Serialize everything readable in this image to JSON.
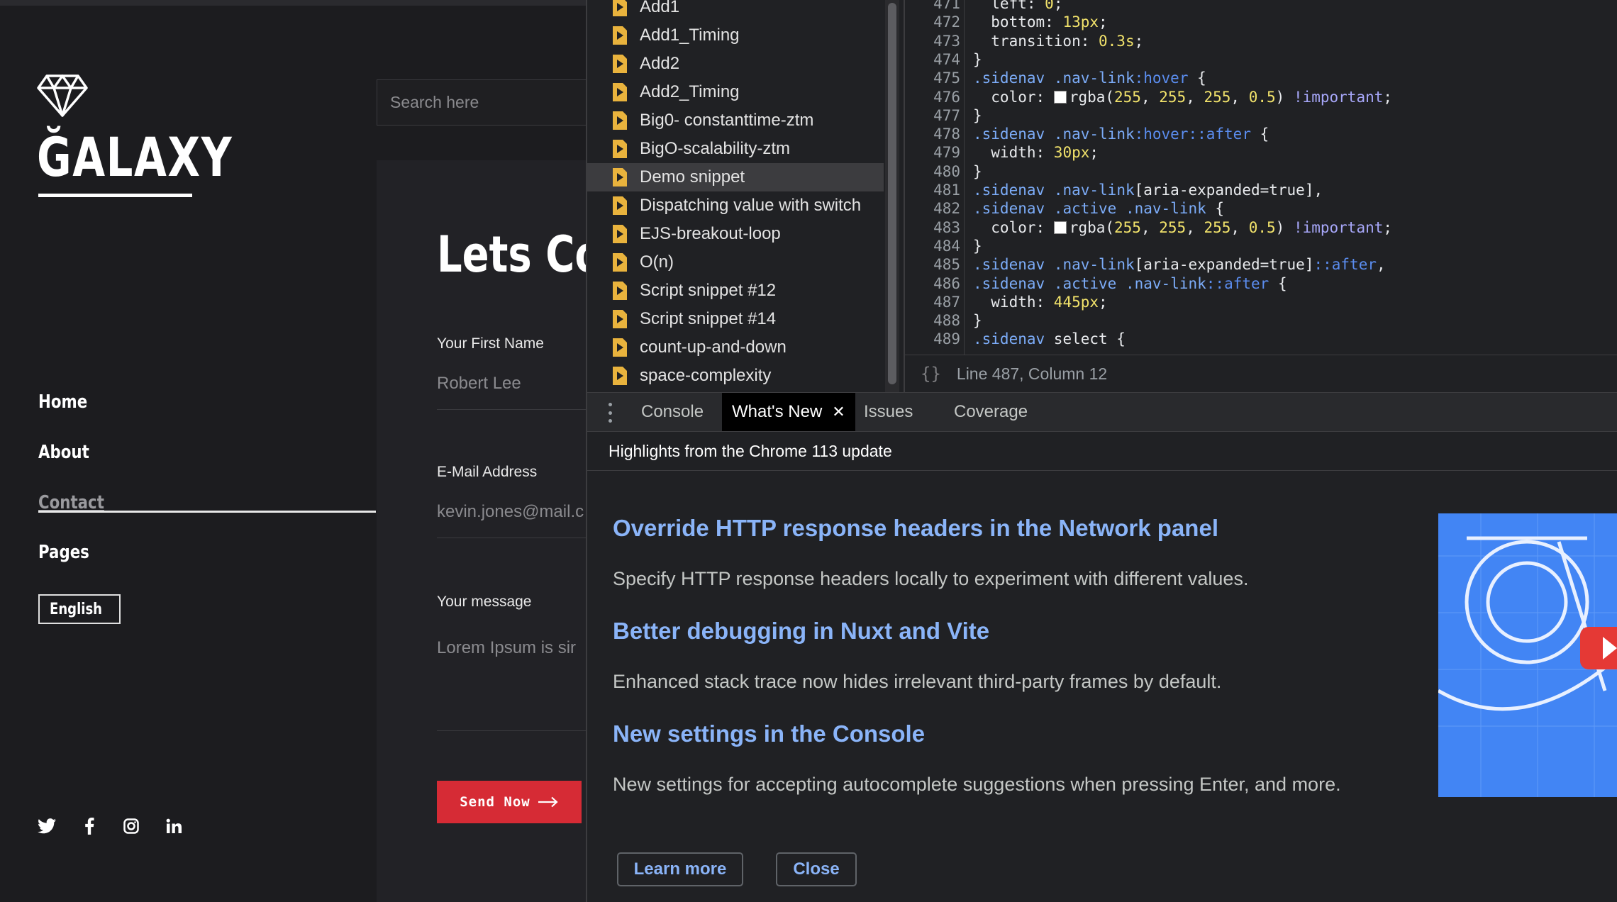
{
  "site": {
    "brand": "ĞALAXY",
    "search_placeholder": "Search here",
    "nav": [
      "Home",
      "About",
      "Contact",
      "Pages"
    ],
    "active_nav": "Contact",
    "language": "English",
    "social": [
      "twitter-icon",
      "facebook-icon",
      "instagram-icon",
      "linkedin-icon"
    ],
    "form": {
      "title": "Lets Cor",
      "first_name_label": "Your First Name",
      "first_name_value": "Robert Lee",
      "email_label": "E-Mail Address",
      "email_value": "kevin.jones@mail.c",
      "message_label": "Your message",
      "message_value": "Lorem Ipsum is sir",
      "send_label": "Send Now"
    }
  },
  "devtools": {
    "snippets": [
      "Add1",
      "Add1_Timing",
      "Add2",
      "Add2_Timing",
      "Big0- constanttime-ztm",
      "BigO-scalability-ztm",
      "Demo snippet",
      "Dispatching value with switch",
      "EJS-breakout-loop",
      "O(n)",
      "Script snippet #12",
      "Script snippet #14",
      "count-up-and-down",
      "space-complexity"
    ],
    "selected_snippet": "Demo snippet",
    "code_lines": [
      {
        "n": "471",
        "t": "  left: 0;"
      },
      {
        "n": "472",
        "t": "  bottom: 13px;"
      },
      {
        "n": "473",
        "t": "  transition: 0.3s;"
      },
      {
        "n": "474",
        "t": "}"
      },
      {
        "n": "475",
        "t": ".sidenav .nav-link:hover {"
      },
      {
        "n": "476",
        "t": "  color: rgba(255, 255, 255, 0.5) !important;"
      },
      {
        "n": "477",
        "t": "}"
      },
      {
        "n": "478",
        "t": ".sidenav .nav-link:hover::after {"
      },
      {
        "n": "479",
        "t": "  width: 30px;"
      },
      {
        "n": "480",
        "t": "}"
      },
      {
        "n": "481",
        "t": ".sidenav .nav-link[aria-expanded=true],"
      },
      {
        "n": "482",
        "t": ".sidenav .active .nav-link {"
      },
      {
        "n": "483",
        "t": "  color: rgba(255, 255, 255, 0.5) !important;"
      },
      {
        "n": "484",
        "t": "}"
      },
      {
        "n": "485",
        "t": ".sidenav .nav-link[aria-expanded=true]::after,"
      },
      {
        "n": "486",
        "t": ".sidenav .active .nav-link::after {"
      },
      {
        "n": "487",
        "t": "  width: 445px;"
      },
      {
        "n": "488",
        "t": "}"
      },
      {
        "n": "489",
        "t": ".sidenav select {"
      }
    ],
    "status": "Line 487, Column 12",
    "tabs": [
      "Console",
      "What's New",
      "Issues",
      "Coverage"
    ],
    "active_tab": "What's New",
    "whats_new": {
      "header": "Highlights from the Chrome 113 update",
      "items": [
        {
          "title": "Override HTTP response headers in the Network panel",
          "desc": "Specify HTTP response headers locally to experiment with different values."
        },
        {
          "title": "Better debugging in Nuxt and Vite",
          "desc": "Enhanced stack trace now hides irrelevant third-party frames by default."
        },
        {
          "title": "New settings in the Console",
          "desc": "New settings for accepting autocomplete suggestions when pressing Enter, and more."
        }
      ],
      "learn_more": "Learn more",
      "close": "Close"
    },
    "colors": {
      "link": "#8ab4f8",
      "selector": "#7cacf8",
      "number": "#f2e36b",
      "accent_red": "#d62b35",
      "banner_blue": "#4285f4"
    }
  }
}
